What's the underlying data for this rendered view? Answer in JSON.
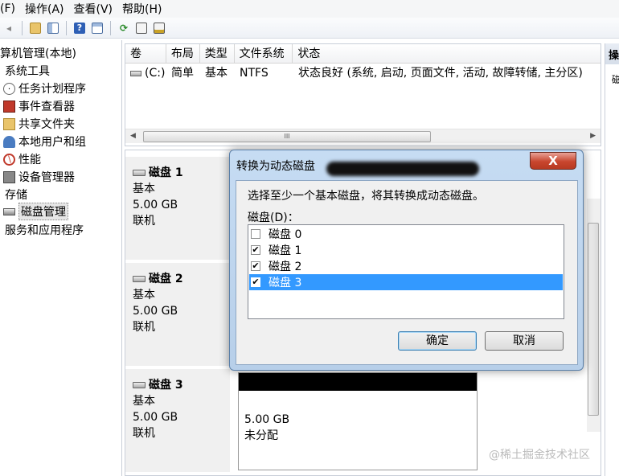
{
  "menu": [
    "(F)",
    "操作(A)",
    "查看(V)",
    "帮助(H)"
  ],
  "tree": {
    "root": "算机管理(本地)",
    "system_tools": "系统工具",
    "items": [
      "任务计划程序",
      "事件查看器",
      "共享文件夹",
      "本地用户和组",
      "性能",
      "设备管理器"
    ],
    "storage": "存储",
    "disk_mgmt": "磁盘管理",
    "services": "服务和应用程序"
  },
  "volume_list": {
    "headers": [
      "卷",
      "布局",
      "类型",
      "文件系统",
      "状态"
    ],
    "rows": [
      [
        "(C:)",
        "简单",
        "基本",
        "NTFS",
        "状态良好 (系统, 启动, 页面文件, 活动, 故障转储, 主分区)"
      ]
    ],
    "scroll_thumb": "III"
  },
  "disks": [
    {
      "name": "磁盘 1",
      "type": "基本",
      "size": "5.00 GB",
      "status": "联机"
    },
    {
      "name": "磁盘 2",
      "type": "基本",
      "size": "5.00 GB",
      "status": "联机"
    },
    {
      "name": "磁盘 3",
      "type": "基本",
      "size": "5.00 GB",
      "status": "联机"
    }
  ],
  "partition3": {
    "size": "5.00 GB",
    "state": "未分配"
  },
  "actions_pane": {
    "head": "操",
    "item": "磁"
  },
  "dialog": {
    "title": "转换为动态磁盘",
    "close": "X",
    "prompt": "选择至少一个基本磁盘，将其转换成动态磁盘。",
    "list_label": "磁盘(D)：",
    "items": [
      {
        "label": "磁盘 0",
        "checked": ""
      },
      {
        "label": "磁盘 1",
        "checked": "✔"
      },
      {
        "label": "磁盘 2",
        "checked": "✔"
      },
      {
        "label": "磁盘 3",
        "checked": "✔"
      }
    ],
    "ok": "确定",
    "cancel": "取消"
  },
  "watermark": "@稀土掘金技术社区",
  "colors": {
    "selection": "#3399ff",
    "title_bar": "#b7cfe9",
    "close_button": "#c8462e"
  }
}
